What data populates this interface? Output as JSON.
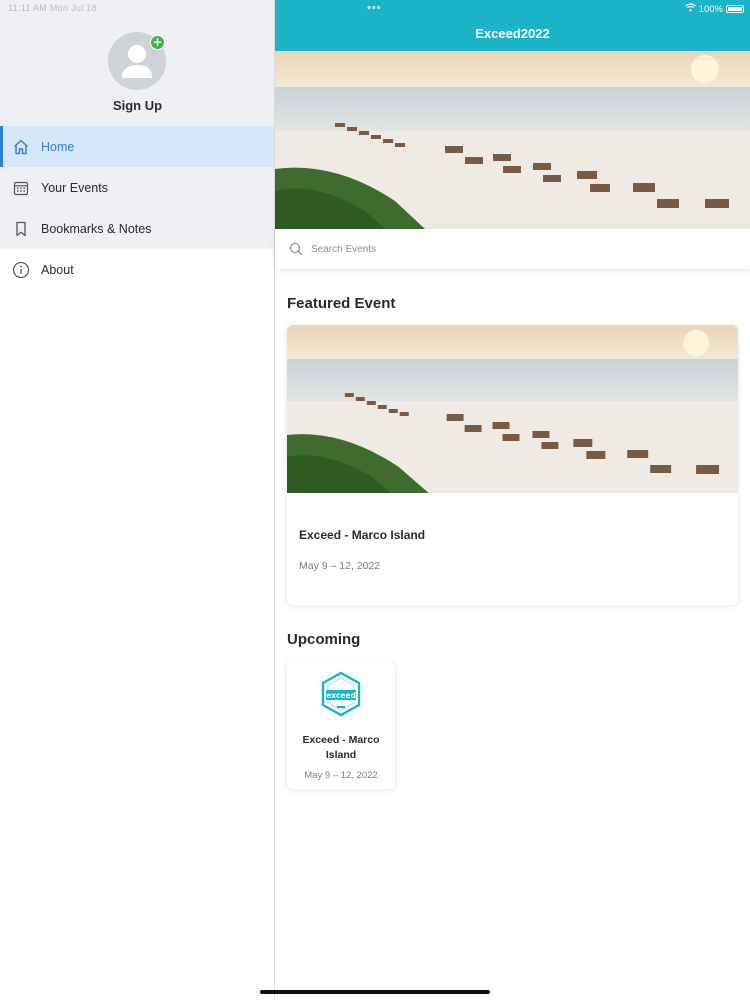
{
  "status": {
    "time": "11:11 AM  Mon Jul 18",
    "dots": "•••",
    "battery": "100%"
  },
  "sidebar": {
    "signup_label": "Sign Up",
    "items": [
      {
        "label": "Home",
        "icon": "home-icon",
        "active": true
      },
      {
        "label": "Your Events",
        "icon": "calendar-icon"
      },
      {
        "label": "Bookmarks & Notes",
        "icon": "bookmark-icon"
      },
      {
        "label": "About",
        "icon": "info-icon"
      }
    ]
  },
  "header": {
    "title": "Exceed2022"
  },
  "search": {
    "placeholder": "Search Events"
  },
  "featured": {
    "section_title": "Featured Event",
    "event_name": "Exceed - Marco Island",
    "event_date": "May 9 – 12, 2022"
  },
  "upcoming": {
    "section_title": "Upcoming",
    "items": [
      {
        "name": "Exceed - Marco Island",
        "date": "May 9 – 12, 2022",
        "logo_text": "exceed"
      }
    ]
  },
  "colors": {
    "accent": "#1ab3c8",
    "active_blue": "#2d7fd8",
    "active_bg": "#d6e7fa",
    "plus_green": "#3cb34a"
  }
}
